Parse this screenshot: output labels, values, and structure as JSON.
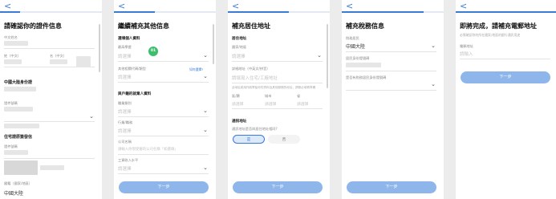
{
  "common": {
    "back_glyph": "<",
    "chevron": "⌄",
    "placeholder_select": "請選擇",
    "next_label": "下一步"
  },
  "screen1": {
    "title": "請確認你的證件信息",
    "fields": [
      {
        "label": "中文姓名"
      },
      {
        "label": "姓（中文）",
        "label2": "名（中文）"
      },
      {
        "label": "性別"
      }
    ],
    "section_id": "中國大陸身份證",
    "id_fields": [
      {
        "label": "證件號碼"
      },
      {
        "label": "出生日期"
      }
    ],
    "section_valid": "住宅證原簽發信",
    "valid_fields": [
      {
        "label": "證件號碼"
      },
      {
        "label": "國籍（國家/地區）",
        "value": "中國大陸"
      }
    ]
  },
  "screen2": {
    "title": "繼續補充其他信息",
    "section_tax": "選填個人資料",
    "tax_fields": [
      {
        "label": "最高學歷"
      },
      {
        "label": "其他相關代碼/類型",
        "hint": "如何選擇?"
      }
    ],
    "badge": "01",
    "section_job": "與戶籍的就業人資料",
    "job_fields": [
      {
        "label": "職業類別"
      },
      {
        "label": "行業/職務"
      },
      {
        "label": "公司名稱",
        "placeholder": "請輸入你現受僱的公司名稱「如選填」"
      },
      {
        "label": "工資收入水平"
      }
    ]
  },
  "screen3": {
    "title": "補充居住地址",
    "section_home": "居住地址",
    "home_fields": [
      {
        "label": "國家/地區"
      },
      {
        "label": "詳細地址（中英文/拼音）",
        "placeholder": "請填寫入住宅/工廠地址"
      }
    ],
    "note": "此地址將用作將寄給你的資料及其他服務的地址，請務必填寫準確",
    "split_labels": [
      "區/縣",
      "城市",
      "省"
    ],
    "split_placeholder": "請選擇",
    "section_mail": "通訊地址",
    "same_question": "通訊地址是否與居住地址相同?",
    "yes": "是",
    "no": "否"
  },
  "screen4": {
    "title": "補充稅務信息",
    "fields": [
      {
        "label": "稅務居民",
        "value": "中國大陸"
      },
      {
        "label": "居民身份證號碼"
      },
      {
        "label": "是否有稅務居民身份證號碼"
      }
    ]
  },
  "screen5": {
    "title": "即將完成，請補充電郵地址",
    "subtitle": "必需確認你的所在國家/地區的銀行通訊用途",
    "email_label": "電郵地址",
    "email_placeholder": "請輸入"
  },
  "colors": {
    "accent": "#3a7bd5",
    "button": "#8fb6ea",
    "badge": "#3bbf6b"
  }
}
